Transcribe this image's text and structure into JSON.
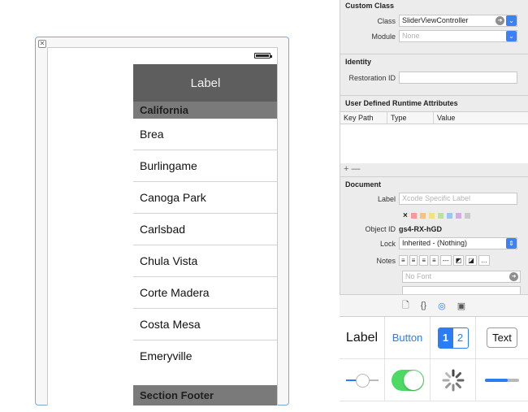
{
  "scene": {
    "panel_header": "Label",
    "section_header": "California",
    "cities": [
      "Brea",
      "Burlingame",
      "Canoga Park",
      "Carlsbad",
      "Chula Vista",
      "Corte Madera",
      "Costa Mesa",
      "Emeryville"
    ],
    "section_footer": "Section Footer"
  },
  "inspector": {
    "custom_class": {
      "title": "Custom Class",
      "class_label": "Class",
      "class_value": "SliderViewController",
      "module_label": "Module",
      "module_placeholder": "None"
    },
    "identity": {
      "title": "Identity",
      "restoration_label": "Restoration ID",
      "restoration_value": ""
    },
    "runtime_attributes": {
      "title": "User Defined Runtime Attributes",
      "columns": [
        "Key Path",
        "Type",
        "Value"
      ],
      "plus_minus": "+ —"
    },
    "document": {
      "title": "Document",
      "label_label": "Label",
      "label_placeholder": "Xcode Specific Label",
      "clear_glyph": "×",
      "swatch_colors": [
        "#f29b9b",
        "#f6c280",
        "#f2e083",
        "#b8e39a",
        "#9bc6f2",
        "#d7a9ea",
        "#c9c9c9"
      ],
      "object_id_label": "Object ID",
      "object_id_value": "gs4-RX-hGD",
      "lock_label": "Lock",
      "lock_value": "Inherited - (Nothing)",
      "notes_label": "Notes",
      "notes_buttons": [
        "≡",
        "≡",
        "≡",
        "≡",
        "---",
        "◩",
        "◪",
        "…"
      ],
      "font_placeholder": "No Font"
    }
  },
  "library": {
    "tabs": [
      "🗋",
      "{}",
      "◎",
      "▣"
    ],
    "items": {
      "label": "Label",
      "button": "Button",
      "segment_1": "1",
      "segment_2": "2",
      "text_field": "Text"
    }
  },
  "colors": {
    "accent": "#2b7df6",
    "header_bg": "#5e5e5e",
    "section_bg": "#7a7a7a",
    "switch_on": "#4cd964"
  }
}
